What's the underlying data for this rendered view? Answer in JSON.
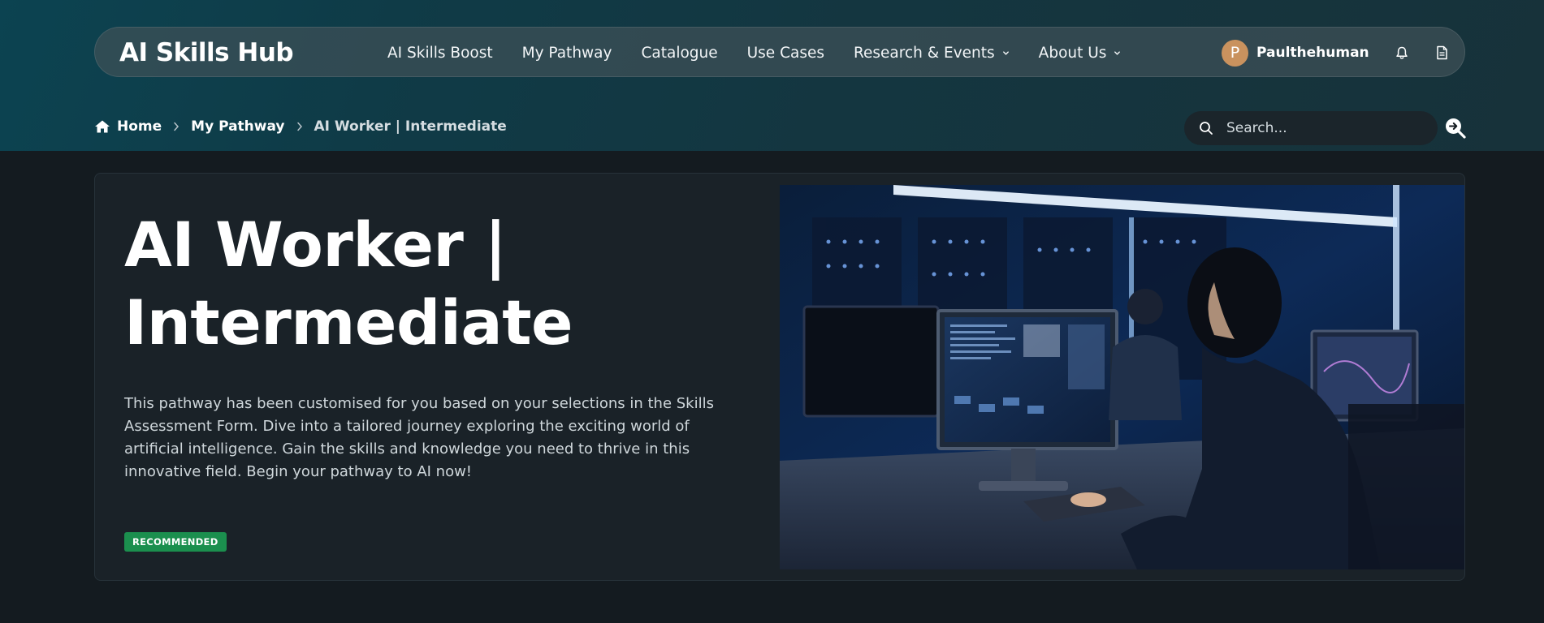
{
  "brand": {
    "name": "AI Skills Hub"
  },
  "nav": {
    "links": [
      {
        "label": "AI Skills Boost",
        "dropdown": false
      },
      {
        "label": "My Pathway",
        "dropdown": false
      },
      {
        "label": "Catalogue",
        "dropdown": false
      },
      {
        "label": "Use Cases",
        "dropdown": false
      },
      {
        "label": "Research & Events",
        "dropdown": true
      },
      {
        "label": "About Us",
        "dropdown": true
      }
    ],
    "user": {
      "avatar_initial": "P",
      "name": "Paulthehuman",
      "icons": [
        "bell-icon",
        "document-icon"
      ]
    }
  },
  "breadcrumb": {
    "home": "Home",
    "parent": "My Pathway",
    "current": "AI Worker | Intermediate"
  },
  "search": {
    "placeholder": "Search..."
  },
  "hero": {
    "title": "AI Worker | Intermediate",
    "description": "This pathway has been customised for you based on your selections in the Skills Assessment Form. Dive into a tailored journey exploring the exciting world of artificial intelligence. Gain the skills and knowledge you need to thrive in this innovative field. Begin your pathway to AI now!",
    "badge": "RECOMMENDED",
    "image_alt": "person-at-computer-photo"
  },
  "colors": {
    "badge_green": "#1b8f4e",
    "avatar": "#c9925e",
    "background": "#141b20",
    "header_band": "#0f3b47"
  }
}
